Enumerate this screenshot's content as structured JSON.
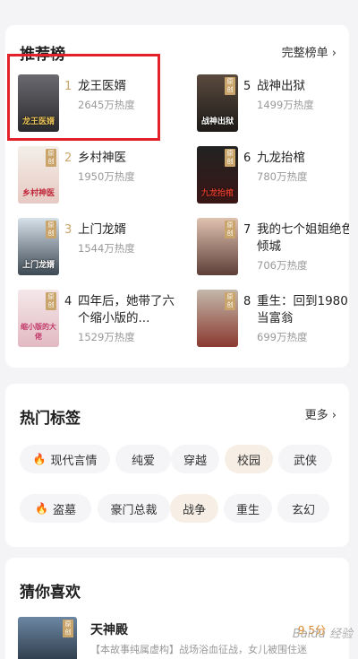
{
  "ranking": {
    "title": "推荐榜",
    "more": "完整榜单 ›",
    "books": [
      {
        "rank": "1",
        "title": "龙王医婿",
        "heat": "2645万热度",
        "cover_text": "龙王医婿",
        "badge": "",
        "colors": [
          "#3b3a3f",
          "#1a1a1c"
        ]
      },
      {
        "rank": "2",
        "title": "乡村神医",
        "heat": "1950万热度",
        "cover_text": "乡村神医",
        "badge": "原创",
        "colors": [
          "#f1ece6",
          "#e9d6cf"
        ]
      },
      {
        "rank": "3",
        "title": "上门龙婿",
        "heat": "1544万热度",
        "cover_text": "上门龙婿",
        "badge": "原创",
        "colors": [
          "#c6d4de",
          "#4a5663"
        ]
      },
      {
        "rank": "4",
        "title": "四年后，她带了六个缩小版的...",
        "heat": "1529万热度",
        "cover_text": "缩小版的大佬",
        "badge": "原创",
        "colors": [
          "#f1e4e6",
          "#e9c8cf"
        ]
      },
      {
        "rank": "5",
        "title": "战神出狱",
        "heat": "1499万热度",
        "cover_text": "战神出狱",
        "badge": "原创",
        "colors": [
          "#2d2a2a",
          "#5a3a2a"
        ]
      },
      {
        "rank": "6",
        "title": "九龙抬棺",
        "heat": "780万热度",
        "cover_text": "九龙抬棺",
        "badge": "原创",
        "colors": [
          "#1b1b1b",
          "#4a1c1c"
        ]
      },
      {
        "rank": "7",
        "title": "我的七个姐姐绝色倾城",
        "heat": "706万热度",
        "cover_text": "",
        "badge": "原创",
        "colors": [
          "#d9b9a8",
          "#6c4a42"
        ]
      },
      {
        "rank": "8",
        "title": "重生：回到1980当富翁",
        "heat": "699万热度",
        "cover_text": "",
        "badge": "原创",
        "colors": [
          "#b6aca0",
          "#8f3b32"
        ]
      }
    ]
  },
  "tags": {
    "title": "热门标签",
    "more": "更多 ›",
    "row1": [
      {
        "label": "现代言情",
        "hot": true,
        "selected": false
      },
      {
        "label": "纯爱",
        "hot": false,
        "selected": false
      },
      {
        "label": "穿越",
        "hot": false,
        "selected": false
      },
      {
        "label": "校园",
        "hot": false,
        "selected": true
      },
      {
        "label": "武侠",
        "hot": false,
        "selected": false
      }
    ],
    "row2": [
      {
        "label": "盗墓",
        "hot": true,
        "selected": false
      },
      {
        "label": "豪门总裁",
        "hot": false,
        "selected": false
      },
      {
        "label": "战争",
        "hot": false,
        "selected": true
      },
      {
        "label": "重生",
        "hot": false,
        "selected": false
      },
      {
        "label": "玄幻",
        "hot": false,
        "selected": false
      }
    ]
  },
  "guess": {
    "title": "猜你喜欢",
    "book": {
      "title": "天神殿",
      "desc": "【本故事纯属虚构】战场浴血征战，女儿被围住迷",
      "score": "9.5分",
      "badge": "原创",
      "colors": [
        "#5b7690",
        "#1f2a35"
      ]
    }
  },
  "watermark": "Baidu 经验",
  "colors": {
    "rank_gold": "#c9a56b",
    "highlight": "#e3212a",
    "fire": "#f06a2a"
  }
}
